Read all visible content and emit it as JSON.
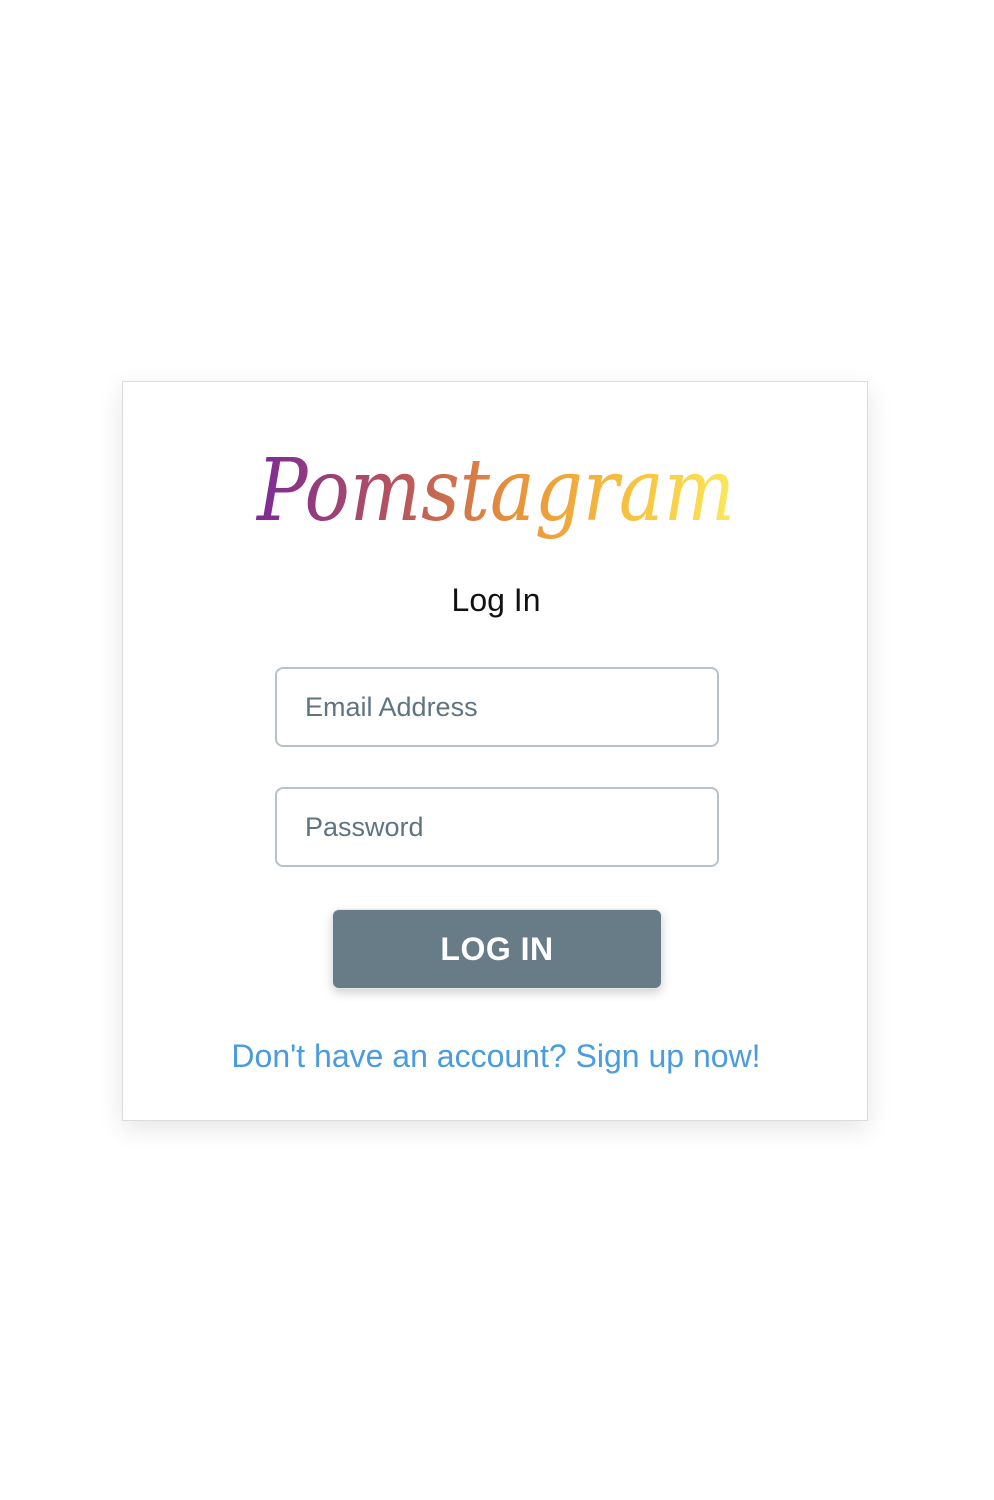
{
  "brand": {
    "name": "Pomstagram",
    "gradient": [
      "#7b2a96",
      "#b8555c",
      "#e9953a",
      "#f8c540",
      "#fbe85a"
    ]
  },
  "login": {
    "heading": "Log In",
    "email_placeholder": "Email Address",
    "password_placeholder": "Password",
    "submit_label": "LOG IN",
    "signup_link": "Don't have an account? Sign up now!"
  },
  "colors": {
    "button": "#687c88",
    "link": "#4a9be0",
    "field_border": "#b8c2c9",
    "placeholder": "#5f7480"
  }
}
